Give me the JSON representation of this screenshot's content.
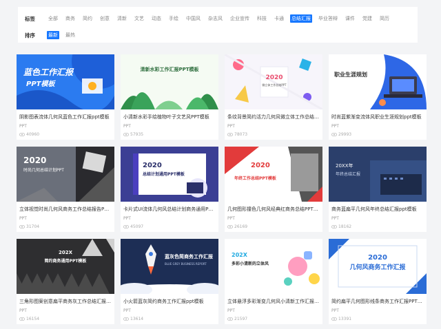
{
  "filters": {
    "tag_label": "标签",
    "tags": [
      "全部",
      "商务",
      "简约",
      "创意",
      "清新",
      "文艺",
      "动态",
      "手绘",
      "中国风",
      "杂志风",
      "企业宣传",
      "科技",
      "卡通",
      "总结汇报",
      "毕业答辩",
      "课件",
      "党建",
      "简历"
    ],
    "active_tag": "总结汇报",
    "sort_label": "排序",
    "sorts": [
      "最新",
      "最热"
    ],
    "active_sort": "最新"
  },
  "cards": [
    {
      "title": "阴影图表流体几何风蓝色工作汇报ppt模板",
      "category": "PPT",
      "views": "40960",
      "thumb_text": "蓝色工作汇报",
      "thumb_sub": "PPT模板"
    },
    {
      "title": "小清新水彩手绘植物叶子文艺风PPT模板",
      "category": "PPT",
      "views": "57935",
      "thumb_text": "清新水彩工作汇报PPT模板",
      "thumb_sub": ""
    },
    {
      "title": "条纹背景简约活力几何风微立体工作总结PPT",
      "category": "PPT",
      "views": "78073",
      "thumb_text": "2020",
      "thumb_sub": "微立体工作总结PPT"
    },
    {
      "title": "时尚蓝紫渐变流体风职业生涯规划ppt模板",
      "category": "PPT",
      "views": "29993",
      "thumb_text": "职业生涯规划",
      "thumb_sub": ""
    },
    {
      "title": "立体视觉时尚几何风商务工作总结报告PPT模板",
      "category": "PPT",
      "views": "31704",
      "thumb_text": "2020",
      "thumb_sub": "时尚几何总结计划PPT"
    },
    {
      "title": "卡片式UI流体几何风总结计划商务通用PPT模板",
      "category": "PPT",
      "views": "45097",
      "thumb_text": "2020",
      "thumb_sub": "总结计划通用PPT模板"
    },
    {
      "title": "几何图形撞色几何风经典红商务总结PPT模板",
      "category": "PPT",
      "views": "26169",
      "thumb_text": "2020",
      "thumb_sub": "年终工作总结PPT模板"
    },
    {
      "title": "商务蓝扁平几何风年终总结汇报ppt模板",
      "category": "PPT",
      "views": "18162",
      "thumb_text": "20XX年",
      "thumb_sub": "年终总结汇报"
    },
    {
      "title": "三角形图案创意扁平商务灰工作总结汇报PPT",
      "category": "PPT",
      "views": "16154",
      "thumb_text": "202X",
      "thumb_sub": "简约商务通用PPT模板"
    },
    {
      "title": "小火箭蓝灰简约商务工作汇报ppt模板",
      "category": "PPT",
      "views": "13614",
      "thumb_text": "蓝灰色简商务工作汇报",
      "thumb_sub": "BLUE GREY BUSINESS REPORT"
    },
    {
      "title": "立体悬浮多彩渐变几何风小清新工作汇报PPT",
      "category": "PPT",
      "views": "21597",
      "thumb_text": "202X",
      "thumb_sub": "多彩小清新的立体风"
    },
    {
      "title": "简约扁平几何图形线条商务工作汇报PPT模板",
      "category": "PPT",
      "views": "13391",
      "thumb_text": "2020",
      "thumb_sub": "几何风商务工作汇报"
    }
  ]
}
